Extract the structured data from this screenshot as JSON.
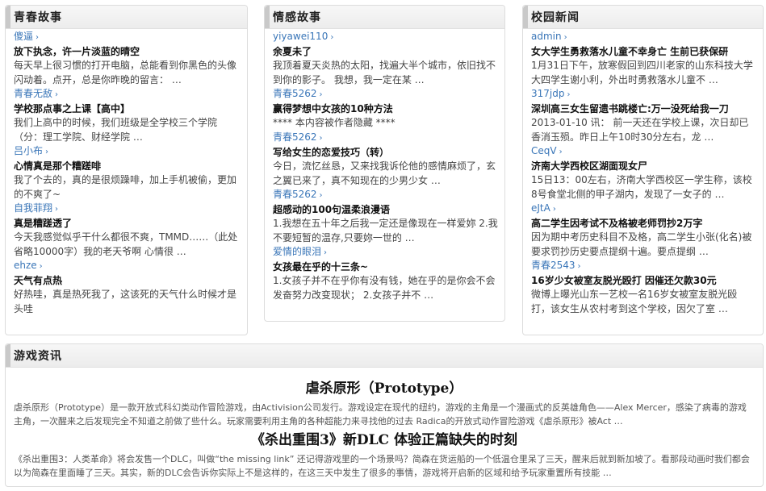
{
  "panels": {
    "youth": {
      "title": "青春故事",
      "items": [
        {
          "author": "傻逼",
          "headline": "放下执念，许一片淡蓝的晴空",
          "desc": "每天早上很习惯的打开电脑，总能看到你黑色的头像闪动着。点开，总是你昨晚的留言：  …"
        },
        {
          "author": "青春无敌",
          "headline": "学校那点事之上课【高中】",
          "desc": "我们上高中的时候，我们班级是全学校三个学院（分：理工学院、财经学院  …"
        },
        {
          "author": "吕小布",
          "headline": "心情真是那个糟蹉啡",
          "desc": "我了个去的，真的是很烦躁啡，加上手机被偷，更加的不爽了~"
        },
        {
          "author": "自我菲翔",
          "headline": "真是糟蹉透了",
          "desc": "今天我感觉似乎干什么都很不爽，TMMD……（此处省略10000字）我的老天爷啊 心情很  …"
        },
        {
          "author": "ehze",
          "headline": "天气有点热",
          "desc": "好热哇，真是热死我了，这该死的天气什么时候才是头哇"
        }
      ]
    },
    "emotion": {
      "title": "情感故事",
      "items": [
        {
          "author": "yiyawei110",
          "headline": "余夏未了",
          "desc": "我顶着夏天炎热的太阳，找遍大半个城市，依旧找不到你的影子。      我想，我一定在某  …"
        },
        {
          "author": "青春5262",
          "headline": "赢得梦想中女孩的10种方法",
          "desc": "**** 本内容被作者隐藏 ****"
        },
        {
          "author": "青春5262",
          "headline": "写给女生的恋爱技巧（转）",
          "desc": "今日，流忆丝恳，又来找我诉伦他的感情麻烦了，玄之翼已来了，真不知现在的少男少女  …"
        },
        {
          "author": "青春5262",
          "headline": "超感动的100句温柔浪漫语",
          "desc": "1.我想在五十年之后我一定还是像现在一样爱妳    2.我不要短暂的温存,只要妳一世的  …"
        },
        {
          "author": "爱情的眼泪",
          "headline": "女孩最在乎的十三条~",
          "desc": "1.女孩子并不在乎你有没有钱，她在乎的是你会不会发奋努力改变现状；  2.女孩子并不  …"
        }
      ]
    },
    "campus": {
      "title": "校园新闻",
      "items": [
        {
          "author": "admin",
          "headline": "女大学生勇救落水儿童不幸身亡 生前已获保研",
          "desc": "1月31日下午，放寒假回到四川老家的山东科技大学大四学生谢小利，外出时勇救落水儿童不  …"
        },
        {
          "author": "317jdp",
          "headline": "深圳高三女生留遗书跳楼亡:万一没死给我一刀",
          "desc": "2013-01-10 讯：      前一天还在学校上课，次日却已香消玉殒。昨日上午10时30分左右，龙  …"
        },
        {
          "author": "CeqV",
          "headline": "济南大学西校区湖面现女尸",
          "desc": "15日13：00左右，济南大学西校区一学生称，该校8号食堂北侧的甲子湖内，发现了一女子的  …"
        },
        {
          "author": "eJtA",
          "headline": "高二学生因考试不及格被老师罚抄2万字",
          "desc": "因为期中考历史科目不及格，高二学生小张(化名)被要求罚抄历史要点提纲十遍。要点提纲  …"
        },
        {
          "author": "青春2543",
          "headline": "16岁少女被室友脱光殴打 因催还欠款30元",
          "desc": "微博上曝光山东一艺校一名16岁女被室友脱光殴打，该女生从农村考到这个学校，因欠了室  …"
        }
      ]
    },
    "games": {
      "title": "游戏资讯",
      "items": [
        {
          "headline": "虐杀原形（Prototype）",
          "desc": "虐杀原形（Prototype）是一款开放式科幻类动作冒险游戏，由Activision公司发行。游戏设定在现代的纽约，游戏的主角是一个漫画式的反英雄角色——Alex Mercer，感染了病毒的游戏主角，一次醒来之后发现完全不知道之前做了些什么。玩家需要利用主角的各种超能力来寻找他的过去  Radica的开放式动作冒险游戏《虐杀原形》被Act  …"
        },
        {
          "headline": "《杀出重围3》新DLC 体验正篇缺失的时刻",
          "desc": "《杀出重围3：人类革命》将会发售一个DLC，叫做“the missing link”      还记得游戏里的一个场景吗？简森在货运船的一个低温仓里呆了三天，醒来后就到新加坡了。看那段动画时我们都会以为简森在里面睡了三天。其实，新的DLC会告诉你实际上不是这样的，在这三天中发生了很多的事情，游戏将开启新的区域和给予玩家重置所有技能  …"
        }
      ]
    }
  }
}
